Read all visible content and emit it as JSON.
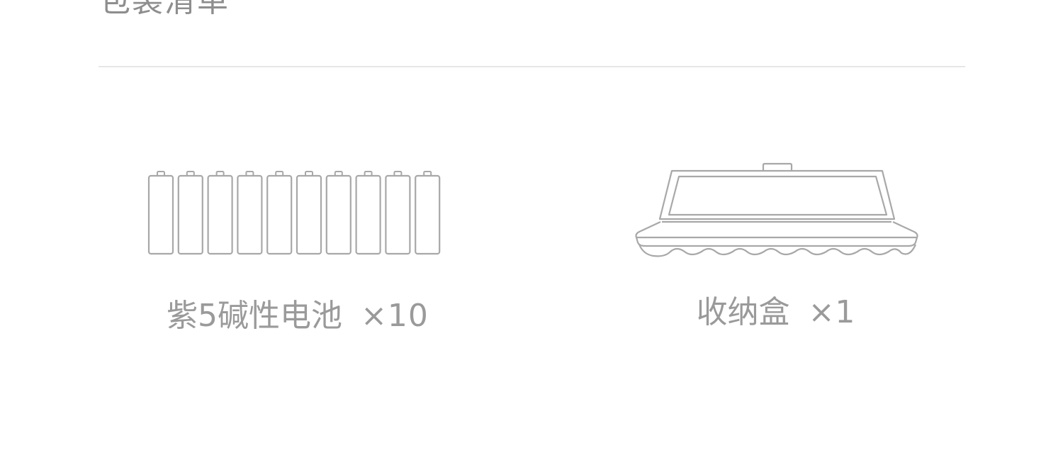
{
  "section": {
    "title": "包装清单"
  },
  "items": [
    {
      "name": "紫5碱性电池",
      "quantity": "×10",
      "icon": "battery-row-icon",
      "battery_count": 10
    },
    {
      "name": "收纳盒",
      "quantity": "×1",
      "icon": "storage-box-icon"
    }
  ],
  "colors": {
    "text": "#9a9a9a",
    "line_art": "#a8a8a8",
    "divider": "#e6e6e6",
    "background": "#ffffff"
  }
}
